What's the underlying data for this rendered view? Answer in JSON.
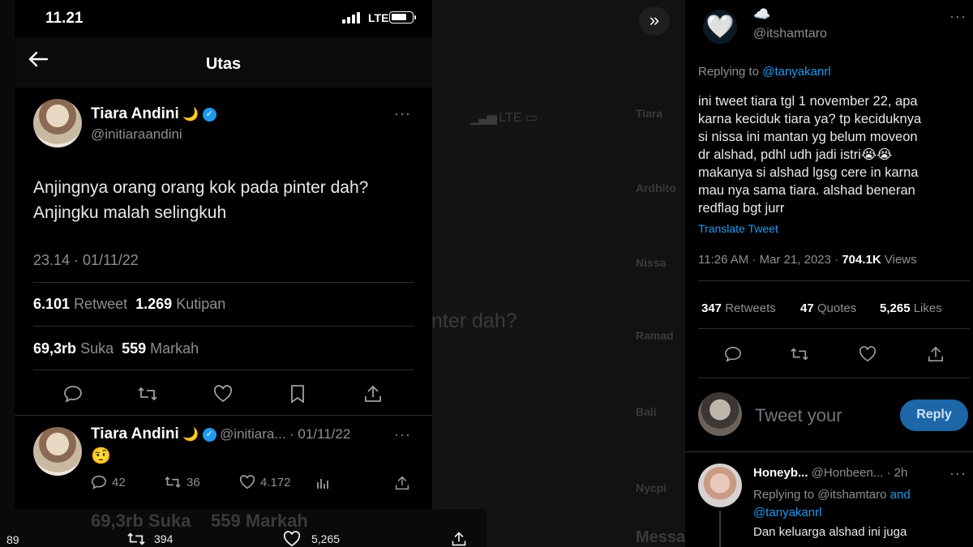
{
  "status_bar": {
    "time": "11.21",
    "network": "LTE"
  },
  "thread": {
    "title": "Utas",
    "main_tweet": {
      "name": "Tiara Andini",
      "emoji": "🌙",
      "handle": "@initiaraandini",
      "text_line1": "Anjingnya orang orang kok pada pinter dah?",
      "text_line2": "Anjingku malah selingkuh",
      "timestamp": "23.14 · 01/11/22",
      "retweets_count": "6.101",
      "retweets_label": "Retweet",
      "quotes_count": "1.269",
      "quotes_label": "Kutipan",
      "likes_count": "69,3rb",
      "likes_label": "Suka",
      "bookmarks_count": "559",
      "bookmarks_label": "Markah"
    },
    "reply_tweet": {
      "name": "Tiara Andini",
      "emoji": "🌙",
      "handle": "@initiara...",
      "date": "· 01/11/22",
      "text": "🤨",
      "replies": "42",
      "retweets": "36",
      "likes": "4.172"
    }
  },
  "background": {
    "ghost_text": "nter dah?",
    "ghost_names": [
      "Tiara",
      "Ardhito",
      "Nissa",
      "Ramad",
      "Bali",
      "Nycpi"
    ],
    "ghost_lte": "LTE",
    "ghost_bottom_likes": "69,3rb Suka",
    "ghost_bottom_bookmarks": "559 Markah",
    "ghost_mess": "Messa",
    "bottom_bar": {
      "count_left": "89",
      "retweets": "394",
      "likes": "5,265"
    }
  },
  "right_tweet": {
    "avatar_emoji": "🤍",
    "name_emoji": "☁️",
    "handle": "@itshamtaro",
    "replying_prefix": "Replying to",
    "replying_to": "@tanyakanrl",
    "lines": [
      "ini tweet tiara tgl 1 november 22, apa",
      "karna keciduk tiara ya? tp keciduknya",
      "si nissa ini mantan yg belum moveon",
      "dr alshad, pdhl udh jadi istri😭😭",
      "makanya si alshad lgsg cere in karna",
      "mau nya sama tiara. alshad beneran",
      "redflag bgt jurr"
    ],
    "translate": "Translate Tweet",
    "timestamp": "11:26 AM · Mar 21, 2023 ·",
    "views_count": "704.1K",
    "views_label": "Views",
    "retweets_count": "347",
    "retweets_label": "Retweets",
    "quotes_count": "47",
    "quotes_label": "Quotes",
    "likes_count": "5,265",
    "likes_label": "Likes",
    "compose_placeholder": "Tweet your",
    "reply_button": "Reply"
  },
  "right_reply": {
    "name": "Honeyb...",
    "handle": "@Honbeen...",
    "time": "· 2h",
    "replying_prefix": "Replying to",
    "replying_to1": "@itshamtaro",
    "and": "and",
    "replying_to2": "@tanyakanrl",
    "text": "Dan keluarga alshad ini juga"
  },
  "colors": {
    "accent": "#1d9bf0",
    "background": "#000000",
    "muted": "#8b8f94",
    "verified": "#1d9bf0"
  }
}
